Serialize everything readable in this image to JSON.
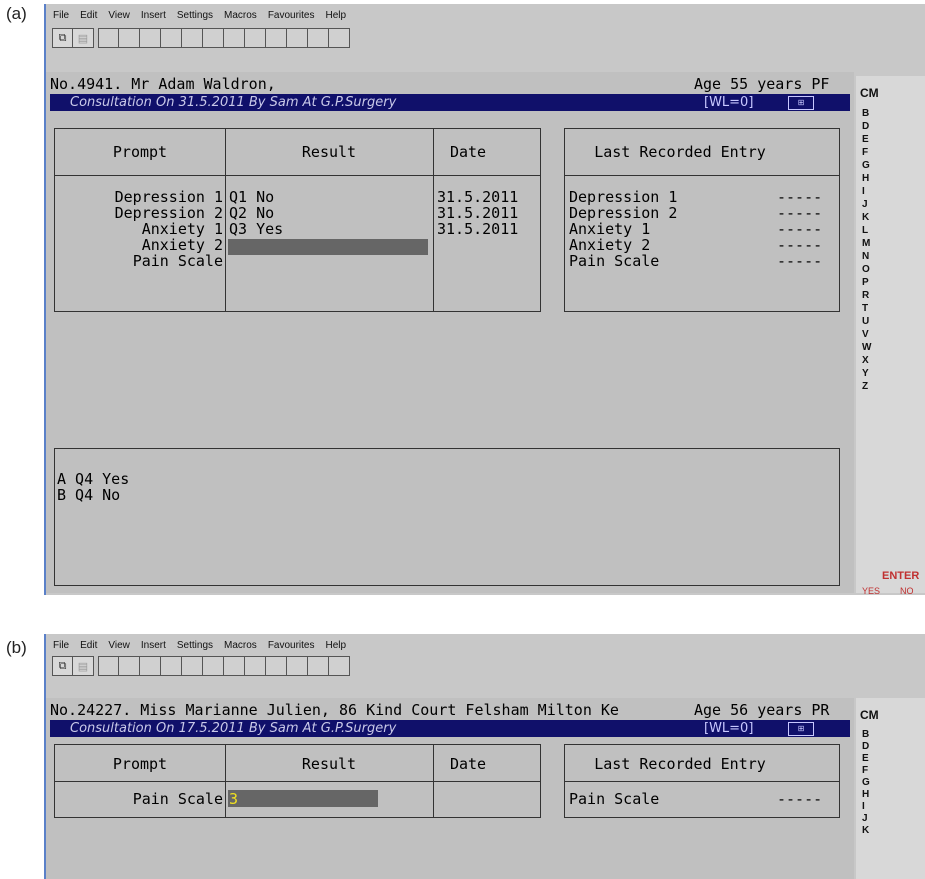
{
  "menu": [
    "File",
    "Edit",
    "View",
    "Insert",
    "Settings",
    "Macros",
    "Favourites",
    "Help"
  ],
  "toolbar_icons": [
    "copy-icon",
    "paste-icon"
  ],
  "panels": [
    {
      "label": "(a)",
      "patient": "No.4941. Mr Adam Waldron,",
      "age": "Age 55 years PF",
      "consultation": "Consultation On 31.5.2011 By  Sam At G.P.Surgery",
      "wl": "[WL=0]",
      "headers": {
        "prompt": "Prompt",
        "result": "Result",
        "date": "Date",
        "last": "Last Recorded Entry"
      },
      "rows": [
        {
          "prompt": "Depression 1",
          "result": "Q1 No",
          "date": "31.5.2011",
          "last": "Depression 1",
          "last_val": "-----"
        },
        {
          "prompt": "Depression 2",
          "result": "Q2 No",
          "date": "31.5.2011",
          "last": "Depression 2",
          "last_val": "-----"
        },
        {
          "prompt": "Anxiety 1",
          "result": "Q3 Yes",
          "date": "31.5.2011",
          "last": "Anxiety 1",
          "last_val": "-----"
        },
        {
          "prompt": "Anxiety 2",
          "result": "",
          "date": "",
          "last": "Anxiety 2",
          "last_val": "-----"
        },
        {
          "prompt": "Pain Scale",
          "result": "",
          "date": "",
          "last": "Pain Scale",
          "last_val": "-----"
        }
      ],
      "options": [
        "A Q4 Yes",
        "B Q4 No"
      ],
      "sidebar": {
        "cm": "CM",
        "letters": [
          "B",
          "D",
          "E",
          "F",
          "G",
          "H",
          "I",
          "J",
          "K",
          "L",
          "M",
          "N",
          "O",
          "P",
          "R",
          "T",
          "U",
          "V",
          "W",
          "X",
          "Y",
          "Z"
        ],
        "enter": "ENTER",
        "yes": "YES",
        "no": "NO"
      }
    },
    {
      "label": "(b)",
      "patient": "No.24227. Miss Marianne Julien, 86 Kind Court Felsham Milton Ke",
      "age": "Age 56 years PR",
      "consultation": "Consultation On 17.5.2011 By  Sam At G.P.Surgery",
      "wl": "[WL=0]",
      "headers": {
        "prompt": "Prompt",
        "result": "Result",
        "date": "Date",
        "last": "Last Recorded Entry"
      },
      "rows": [
        {
          "prompt": "Pain Scale",
          "result": "3",
          "date": "",
          "last": "Pain Scale",
          "last_val": "-----"
        }
      ],
      "sidebar": {
        "cm": "CM",
        "letters": [
          "B",
          "D",
          "E",
          "F",
          "G",
          "H",
          "I",
          "J",
          "K"
        ]
      }
    }
  ]
}
